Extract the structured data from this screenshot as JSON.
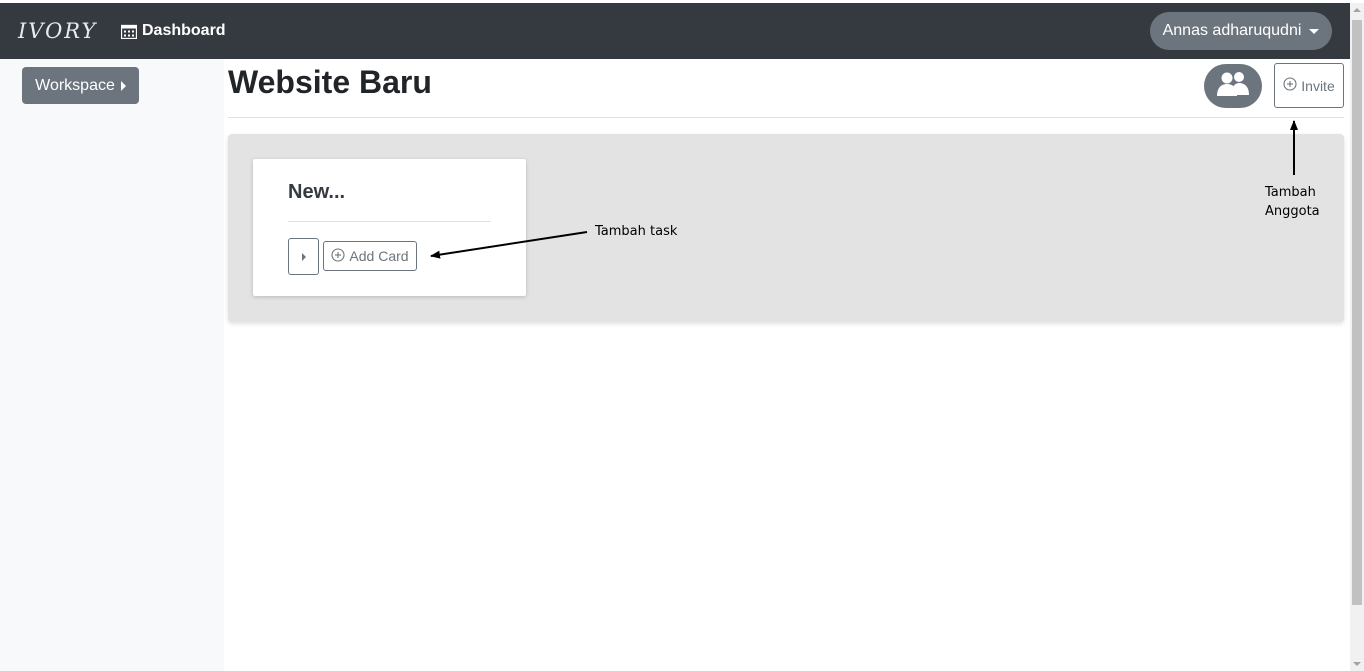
{
  "navbar": {
    "brand": "IVORY",
    "dashboard_label": "Dashboard",
    "user_label": "Annas adharuqudni"
  },
  "sidebar": {
    "workspace_label": "Workspace"
  },
  "page": {
    "title": "Website Baru",
    "invite_label": "Invite"
  },
  "board": {
    "lists": [
      {
        "title": "New...",
        "add_card_label": "Add Card"
      }
    ]
  },
  "annotations": {
    "add_task": "Tambah task",
    "add_member_line1": "Tambah",
    "add_member_line2": "Anggota"
  },
  "colors": {
    "navbar_bg": "#343a40",
    "secondary": "#6c757d",
    "sidebar_bg": "#f8f9fa",
    "board_bg": "#e3e3e3"
  },
  "icons": {
    "dashboard": "calendar-icon",
    "members": "users-icon",
    "invite": "plus-circle-icon",
    "add_card": "plus-circle-icon"
  }
}
